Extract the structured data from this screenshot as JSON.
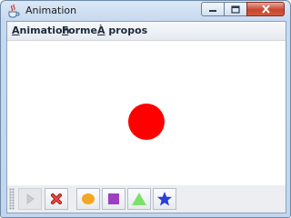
{
  "window": {
    "title": "Animation",
    "icon": "java-cup-icon"
  },
  "menubar": {
    "items": [
      {
        "label": "Animation",
        "mnemonic": "A",
        "rest": "nimation"
      },
      {
        "label": "Forme",
        "mnemonic": "F",
        "rest": "orme"
      },
      {
        "label": "À propos",
        "mnemonic": "À",
        "rest": " propos"
      }
    ]
  },
  "canvas": {
    "shape": "circle",
    "shape_color": "#ff0000",
    "background": "#ffffff"
  },
  "toolbar": {
    "buttons": [
      {
        "icon": "play-icon",
        "enabled": false
      },
      {
        "icon": "stop-icon",
        "enabled": true
      },
      {
        "icon": "circle-shape-icon",
        "color": "#f5a623"
      },
      {
        "icon": "square-shape-icon",
        "color": "#9b3fc0"
      },
      {
        "icon": "triangle-shape-icon",
        "color": "#7ee06a"
      },
      {
        "icon": "star-shape-icon",
        "color": "#2a3fd6"
      }
    ]
  }
}
